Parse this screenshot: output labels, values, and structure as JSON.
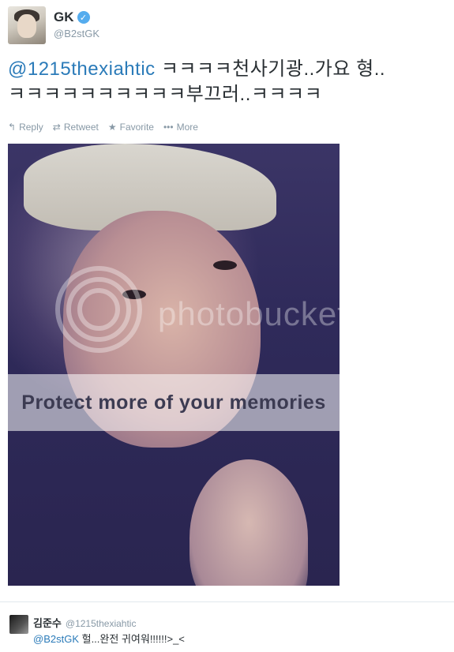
{
  "tweet": {
    "user": {
      "display_name": "GK",
      "handle": "@B2stGK",
      "verified": true
    },
    "text": {
      "mention": "@1215thexiahtic",
      "line1_rest": " ㅋㅋㅋㅋ천사기광..가요 형..",
      "line2": "ㅋㅋㅋㅋㅋㅋㅋㅋㅋㅋ부끄러..ㅋㅋㅋㅋ"
    },
    "actions": [
      {
        "icon": "reply-icon",
        "label": "Reply"
      },
      {
        "icon": "retweet-icon",
        "label": "Retweet"
      },
      {
        "icon": "star-icon",
        "label": "Favorite"
      },
      {
        "icon": "more-icon",
        "label": "More"
      }
    ],
    "photo": {
      "watermark_brand": "photobucket",
      "watermark_tagline": "Protect more of your memories"
    }
  },
  "reply": {
    "display_name": "김준수",
    "handle": "@1215thexiahtic",
    "mention": "@B2stGK",
    "text": " 헐...완전 귀여워!!!!!!>_<"
  },
  "colors": {
    "link": "#2b7bb9",
    "verified": "#55acee",
    "muted": "#8899a6"
  }
}
